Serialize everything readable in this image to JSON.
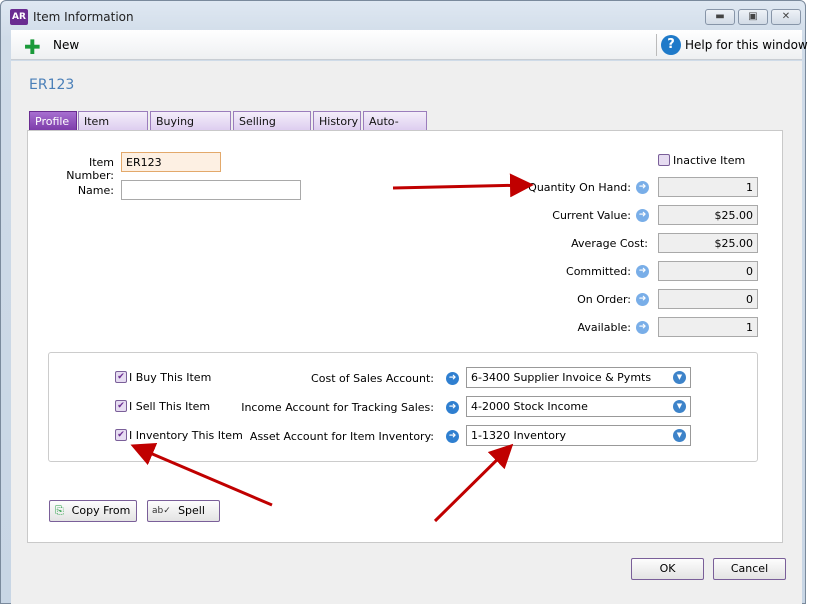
{
  "window": {
    "title": "Item Information",
    "app_icon": "AR"
  },
  "toolbar": {
    "new_label": "New",
    "help_label": "Help for this window"
  },
  "item_id": "ER123",
  "tabs": [
    {
      "label": "Profile",
      "active": true
    },
    {
      "label": "Item Details"
    },
    {
      "label": "Buying Details"
    },
    {
      "label": "Selling Details"
    },
    {
      "label": "History"
    },
    {
      "label": "Auto-Build"
    }
  ],
  "profile": {
    "item_number_label": "Item Number:",
    "item_number": "ER123",
    "name_label": "Name:",
    "name": "",
    "inactive_label": "Inactive Item",
    "inactive": false,
    "stats": [
      {
        "label": "Quantity On Hand:",
        "value": "1"
      },
      {
        "label": "Current Value:",
        "value": "$25.00"
      },
      {
        "label": "Average Cost:",
        "value": "$25.00"
      },
      {
        "label": "Committed:",
        "value": "0"
      },
      {
        "label": "On Order:",
        "value": "0"
      },
      {
        "label": "Available:",
        "value": "1"
      }
    ],
    "checks": [
      {
        "label": "I Buy This Item",
        "checked": true
      },
      {
        "label": "I Sell This Item",
        "checked": true
      },
      {
        "label": "I Inventory This Item",
        "checked": true
      }
    ],
    "accounts": [
      {
        "label": "Cost of Sales Account:",
        "value": "6-3400 Supplier Invoice & Pymts"
      },
      {
        "label": "Income Account for Tracking Sales:",
        "value": "4-2000 Stock Income"
      },
      {
        "label": "Asset Account for Item Inventory:",
        "value": "1-1320 Inventory"
      }
    ]
  },
  "buttons": {
    "copy_from": "Copy From",
    "spell": "Spell",
    "ok": "OK",
    "cancel": "Cancel"
  },
  "colors": {
    "accent": "#6a2c91",
    "annotation": "#c00000"
  }
}
